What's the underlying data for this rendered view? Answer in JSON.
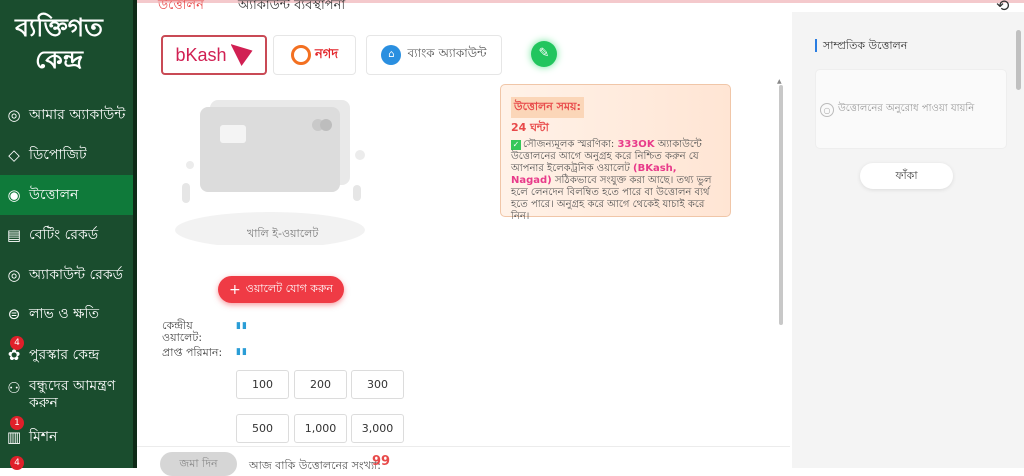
{
  "sidebar": {
    "title": "ব্যক্তিগত কেন্দ্র",
    "items": [
      {
        "label": "আমার অ্যাকাউন্ট",
        "icon": "account-icon"
      },
      {
        "label": "ডিপোজিট",
        "icon": "deposit-icon"
      },
      {
        "label": "উত্তোলন",
        "icon": "withdraw-icon",
        "active": true
      },
      {
        "label": "বেটিং রেকর্ড",
        "icon": "betting-record-icon"
      },
      {
        "label": "অ্যাকাউন্ট রেকর্ড",
        "icon": "account-record-icon"
      },
      {
        "label": "লাভ ও ক্ষতি",
        "icon": "profit-loss-icon"
      },
      {
        "label": "পুরস্কার কেন্দ্র",
        "icon": "reward-center-icon",
        "badge": "4"
      },
      {
        "label": "বন্ধুদের আমন্ত্রণ করুন",
        "icon": "invite-friends-icon"
      },
      {
        "label": "মিশন",
        "icon": "mission-icon",
        "badge": "1"
      },
      {
        "label": "",
        "icon": "more-icon",
        "badge": "4"
      }
    ]
  },
  "tabs": [
    {
      "label": "উত্তোলন",
      "active": true
    },
    {
      "label": "অ্যাকাউন্ট ব্যবস্থাপনা",
      "active": false
    }
  ],
  "payment_methods": [
    {
      "label": "bKash",
      "active": true
    },
    {
      "label": "নগদ",
      "active": false
    },
    {
      "label": "ব্যাংক অ্যাকাউন্ট",
      "active": false
    }
  ],
  "wallet": {
    "empty_label": "খালি ই-ওয়ালেট",
    "add_button": "ওয়ালেট যোগ করুন"
  },
  "info": {
    "title": "উত্তোলন সময়:",
    "hours": "24 ঘন্টা",
    "body_prefix": "সৌজন্যমূলক স্মরণিকা: ",
    "brand": "333OK",
    "body_mid": " অ্যাকাউন্টে উত্তোলনের আগে অনুগ্রহ করে নিশ্চিত করুন যে আপনার ইলেকট্রনিক ওয়ালেট ",
    "wallets": "(BKash, Nagad)",
    "body_suffix": " সঠিকভাবে সংযুক্ত করা আছে। তথ্য ভুল হলে লেনদেন বিলম্বিত হতে পারে বা উত্তোলন ব্যর্থ হতে পারে। অনুগ্রহ করে আগে থেকেই যাচাই করে নিন।"
  },
  "fields": {
    "central_wallet": "কেন্দ্রীয় ওয়ালেট:",
    "received_amount": "প্রাপ্ত পরিমান:"
  },
  "amounts": [
    "100",
    "200",
    "300",
    "500",
    "1,000",
    "3,000"
  ],
  "bottom": {
    "submit": "জমা দিন",
    "remaining_label": "আজ বাকি উত্তোলনের সংখ্যা:",
    "remaining_count": "99"
  },
  "right_panel": {
    "title": "সাম্প্রতিক উত্তোলন",
    "empty_text": "উত্তোলনের অনুরোধ পাওয়া যায়নি",
    "button": "ফাঁকা"
  },
  "colors": {
    "sidebar_bg": "#1a4d2e",
    "active_bg": "#0f7a3a",
    "accent_red": "#ef3b45"
  }
}
